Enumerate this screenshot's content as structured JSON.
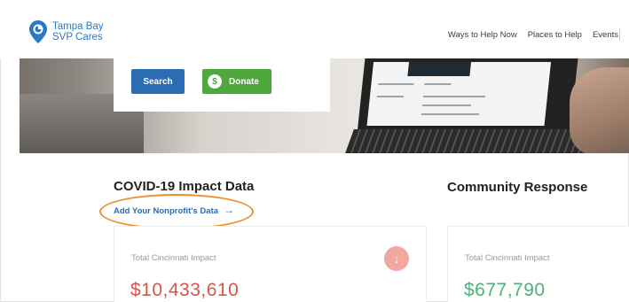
{
  "header": {
    "logo_line1": "Tampa Bay",
    "logo_line2": "SVP Cares",
    "brand_color": "#2b78c9",
    "nav": [
      "Ways to Help Now",
      "Places to Help",
      "Events"
    ]
  },
  "hero": {
    "search_label": "Search",
    "donate_label": "Donate",
    "donate_icon_glyph": "$"
  },
  "covid": {
    "title": "COVID-19 Impact Data",
    "add_link": "Add Your Nonprofit's Data",
    "arrow": "→",
    "card_label": "Total Cincinnati Impact",
    "card_value": "$10,433,610",
    "trend_icon": "↓",
    "value_color": "#d8534a"
  },
  "community": {
    "title": "Community Response",
    "card_label": "Total Cincinnati Impact",
    "card_value": "$677,790",
    "value_color": "#4fae7a"
  },
  "annotation": {
    "highlight_color": "#ef8e2c"
  }
}
